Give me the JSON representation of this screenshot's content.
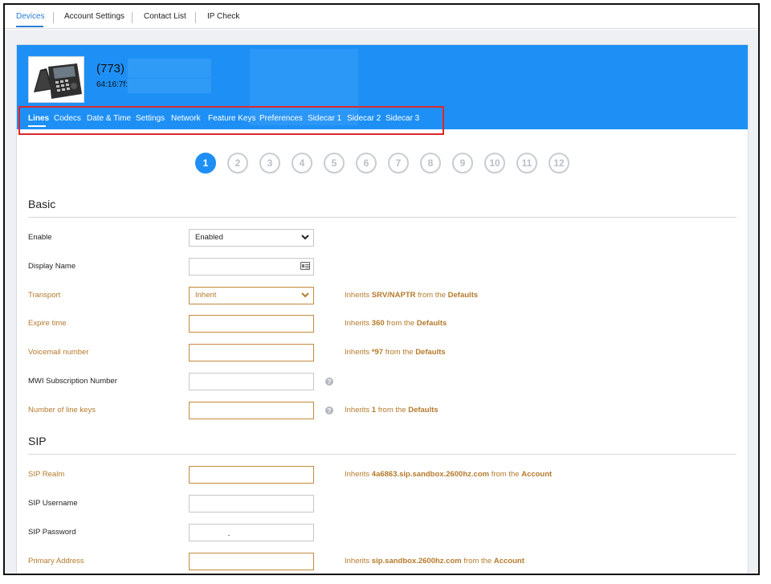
{
  "topnav": {
    "tabs": [
      {
        "label": "Devices"
      },
      {
        "label": "Account Settings"
      },
      {
        "label": "Contact List"
      },
      {
        "label": "IP Check"
      }
    ]
  },
  "device": {
    "number": "(773)",
    "mac": "64:16:7f:"
  },
  "subtabs": [
    "Lines",
    "Codecs",
    "Date & Time",
    "Settings",
    "Network",
    "Feature Keys",
    "Preferences",
    "Sidecar 1",
    "Sidecar 2",
    "Sidecar 3"
  ],
  "lines": [
    "1",
    "2",
    "3",
    "4",
    "5",
    "6",
    "7",
    "8",
    "9",
    "10",
    "11",
    "12"
  ],
  "basic": {
    "title": "Basic",
    "enable": {
      "label": "Enable",
      "value": "Enabled"
    },
    "display_name": {
      "label": "Display Name",
      "value": ""
    },
    "transport": {
      "label": "Transport",
      "value": "Inherit",
      "inherit_pre": "Inherits ",
      "inherit_value": "SRV/NAPTR",
      "inherit_mid": " from the ",
      "inherit_source": "Defaults"
    },
    "expire_time": {
      "label": "Expire time",
      "value": "",
      "inherit_pre": "Inherits ",
      "inherit_value": "360",
      "inherit_mid": " from the ",
      "inherit_source": "Defaults"
    },
    "voicemail": {
      "label": "Voicemail number",
      "value": "",
      "inherit_pre": "Inherits ",
      "inherit_value": "*97",
      "inherit_mid": " from the ",
      "inherit_source": "Defaults"
    },
    "mwi": {
      "label": "MWI Subscription Number",
      "value": ""
    },
    "line_keys": {
      "label": "Number of line keys",
      "value": "",
      "inherit_pre": "Inherits ",
      "inherit_value": "1",
      "inherit_mid": " from the ",
      "inherit_source": "Defaults"
    }
  },
  "sip": {
    "title": "SIP",
    "realm": {
      "label": "SIP Realm",
      "value": "",
      "inherit_pre": "Inherits ",
      "inherit_value": "4a6863.sip.sandbox.2600hz.com",
      "inherit_mid": " from the ",
      "inherit_source": "Account"
    },
    "username": {
      "label": "SIP Username",
      "value": ""
    },
    "password": {
      "label": "SIP Password",
      "value": ""
    },
    "primary_address": {
      "label": "Primary Address",
      "value": "",
      "inherit_pre": "Inherits ",
      "inherit_value": "sip.sandbox.2600hz.com",
      "inherit_mid": " from the ",
      "inherit_source": "Account"
    }
  },
  "colors": {
    "accent": "#1e90f5",
    "inherit_text": "#b57a2c",
    "highlight": "#e0262b"
  }
}
